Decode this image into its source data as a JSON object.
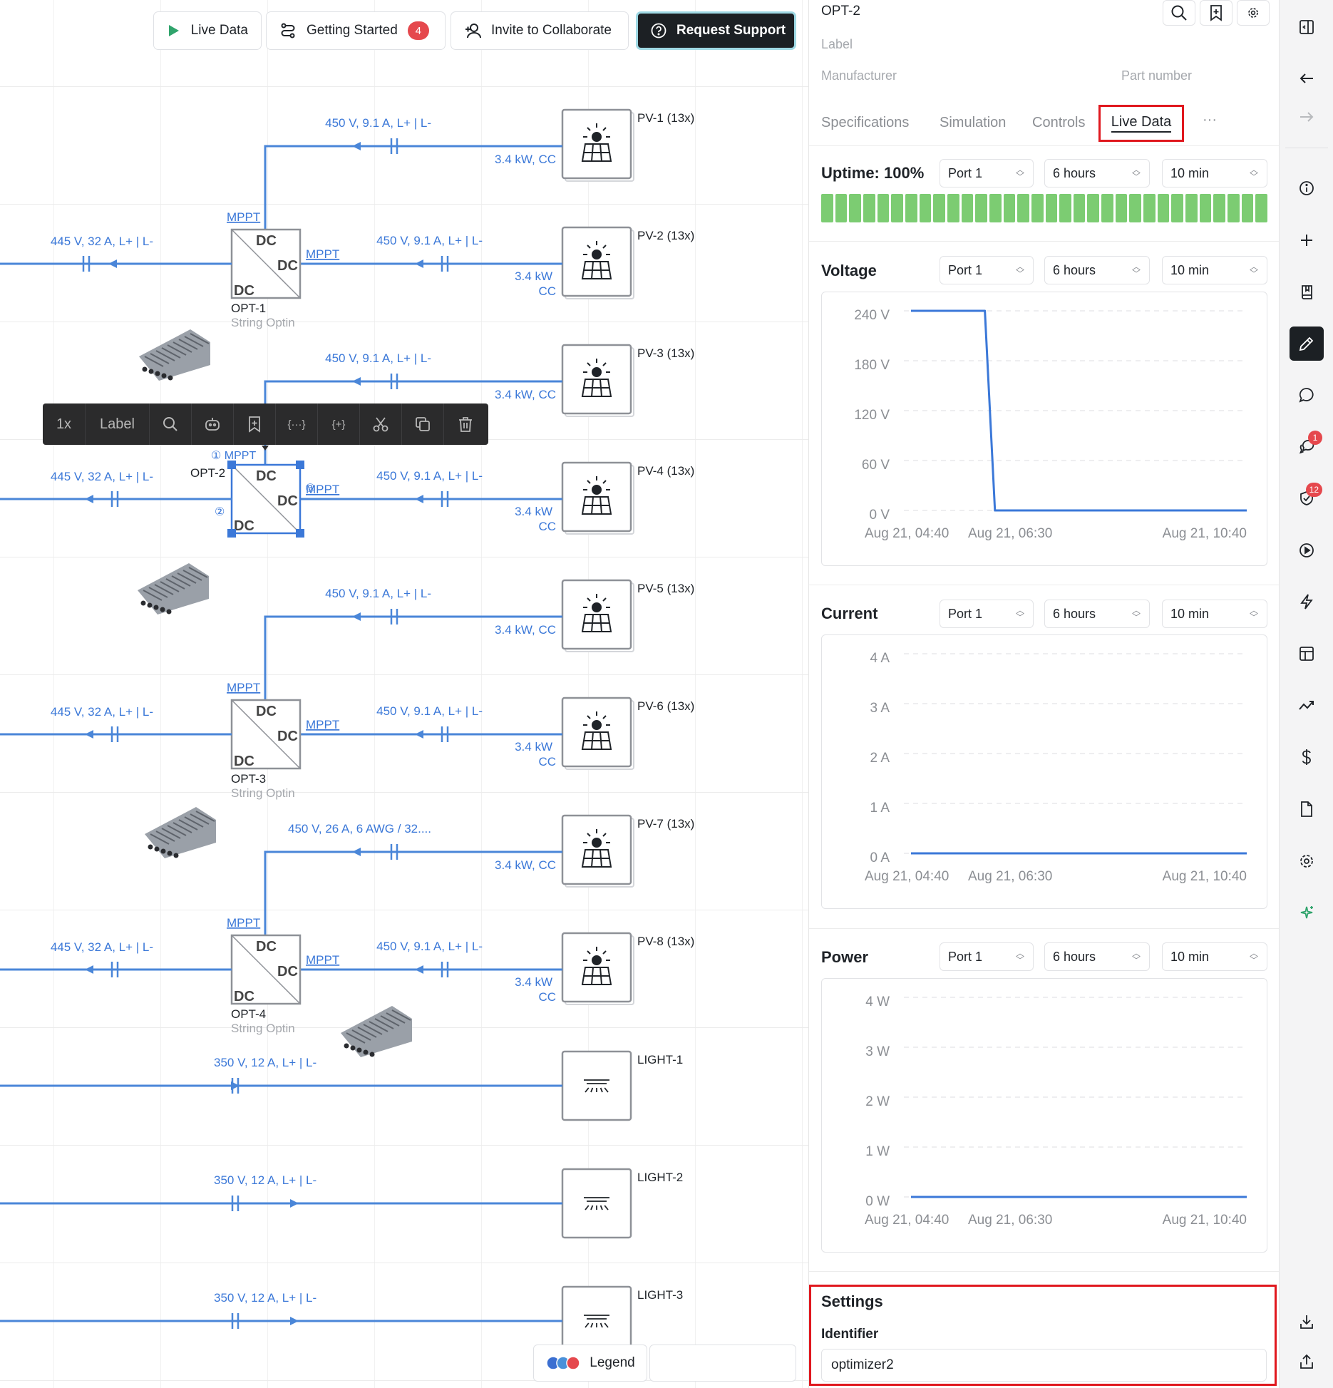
{
  "toolbar": {
    "live_data": "Live Data",
    "getting_started": "Getting Started",
    "getting_started_badge": "4",
    "invite": "Invite to Collaborate",
    "request_support": "Request Support"
  },
  "selection_toolbar": {
    "zoom": "1x",
    "label": "Label",
    "icons": [
      "search-icon",
      "robot-icon",
      "bookmark-plus-icon",
      "braces-icon",
      "braces-plus-icon",
      "cut-icon",
      "copy-icon",
      "trash-icon"
    ]
  },
  "diagram": {
    "pv_panels": [
      {
        "name": "PV-1 (13x)",
        "wire": "450 V, 9.1 A, L+ | L-",
        "power": "3.4 kW, CC"
      },
      {
        "name": "PV-2 (13x)",
        "wire": "450 V, 9.1 A, L+ | L-",
        "power": "3.4 kW CC"
      },
      {
        "name": "PV-3 (13x)",
        "wire": "450 V, 9.1 A, L+ | L-",
        "power": "3.4 kW, CC"
      },
      {
        "name": "PV-4 (13x)",
        "wire": "450 V, 9.1 A, L+ | L-",
        "power": "3.4 kW CC"
      },
      {
        "name": "PV-5 (13x)",
        "wire": "450 V, 9.1 A, L+ | L-",
        "power": "3.4 kW, CC"
      },
      {
        "name": "PV-6 (13x)",
        "wire": "450 V, 9.1 A, L+ | L-",
        "power": "3.4 kW CC"
      },
      {
        "name": "PV-7 (13x)",
        "wire": "450 V, 26 A, 6 AWG / 32....",
        "power": "3.4 kW, CC"
      },
      {
        "name": "PV-8 (13x)",
        "wire": "450 V, 9.1 A, L+ | L-",
        "power": "3.4 kW CC"
      }
    ],
    "optimizers": [
      {
        "name": "OPT-1",
        "sub": "String Optin",
        "out_wire": "445 V, 32 A, L+ | L-"
      },
      {
        "name": "OPT-2",
        "sub": "",
        "out_wire": "445 V, 32 A, L+ | L-"
      },
      {
        "name": "OPT-3",
        "sub": "String Optin",
        "out_wire": "445 V, 32 A, L+ | L-"
      },
      {
        "name": "OPT-4",
        "sub": "String Optin",
        "out_wire": "445 V, 32 A, L+ | L-"
      }
    ],
    "converter_label": "DC",
    "mppt_label": "MPPT",
    "port_markers": [
      "①",
      "②",
      "③"
    ],
    "lights": [
      {
        "name": "LIGHT-1",
        "wire": "350 V, 12 A, L+ | L-"
      },
      {
        "name": "LIGHT-2",
        "wire": "350 V, 12 A, L+ | L-"
      },
      {
        "name": "LIGHT-3",
        "wire": "350 V, 12 A, L+ | L-"
      }
    ]
  },
  "legend": {
    "label": "Legend",
    "colors": [
      "#3b6fd1",
      "#4a90d9",
      "#e5484d"
    ]
  },
  "panel": {
    "title": "OPT-2",
    "label_placeholder": "Label",
    "manufacturer_placeholder": "Manufacturer",
    "part_placeholder": "Part number",
    "tabs": [
      "Specifications",
      "Simulation",
      "Controls",
      "Live Data"
    ],
    "active_tab": "Live Data",
    "more": "···",
    "uptime": {
      "label": "Uptime: 100%",
      "port": "Port 1",
      "range": "6 hours",
      "interval": "10 min",
      "segments": 32,
      "color": "#7ccc72"
    },
    "x_labels": [
      "Aug 21, 04:40",
      "Aug 21, 06:30",
      "Aug 21, 10:40"
    ],
    "voltage": {
      "title": "Voltage",
      "port": "Port 1",
      "range": "6 hours",
      "interval": "10 min",
      "y_ticks": [
        "240 V",
        "180 V",
        "120 V",
        "60 V",
        "0 V"
      ]
    },
    "current": {
      "title": "Current",
      "port": "Port 1",
      "range": "6 hours",
      "interval": "10 min",
      "y_ticks": [
        "4 A",
        "3 A",
        "2 A",
        "1 A",
        "0 A"
      ]
    },
    "power": {
      "title": "Power",
      "port": "Port 1",
      "range": "6 hours",
      "interval": "10 min",
      "y_ticks": [
        "4 W",
        "3 W",
        "2 W",
        "1 W",
        "0 W"
      ]
    },
    "settings": {
      "title": "Settings",
      "identifier_label": "Identifier",
      "identifier_value": "optimizer2"
    }
  },
  "chart_data": [
    {
      "type": "line",
      "title": "Voltage",
      "ylim": [
        0,
        240
      ],
      "y_ticks": [
        240,
        180,
        120,
        60,
        0
      ],
      "x_labels": [
        "Aug 21, 04:40",
        "Aug 21, 06:30",
        "Aug 21, 10:40"
      ],
      "series": [
        {
          "values": [
            [
              0,
              240
            ],
            [
              0.22,
              240
            ],
            [
              0.25,
              0
            ],
            [
              1,
              0
            ]
          ]
        }
      ]
    },
    {
      "type": "line",
      "title": "Current",
      "ylim": [
        0,
        4
      ],
      "y_ticks": [
        4,
        3,
        2,
        1,
        0
      ],
      "x_labels": [
        "Aug 21, 04:40",
        "Aug 21, 06:30",
        "Aug 21, 10:40"
      ],
      "series": [
        {
          "values": [
            [
              0,
              0
            ],
            [
              1,
              0
            ]
          ]
        }
      ]
    },
    {
      "type": "line",
      "title": "Power",
      "ylim": [
        0,
        4
      ],
      "y_ticks": [
        4,
        3,
        2,
        1,
        0
      ],
      "x_labels": [
        "Aug 21, 04:40",
        "Aug 21, 06:30",
        "Aug 21, 10:40"
      ],
      "series": [
        {
          "values": [
            [
              0,
              0
            ],
            [
              1,
              0
            ]
          ]
        }
      ]
    }
  ],
  "rail": {
    "icons": [
      "panel-toggle-icon",
      "arrow-left-icon",
      "arrow-right-icon",
      "info-icon",
      "plus-icon",
      "book-icon",
      "pencil-icon",
      "comment-icon",
      "comments-icon",
      "shield-check-icon",
      "play-icon",
      "bolt-icon",
      "table-icon",
      "trend-icon",
      "dollar-icon",
      "file-icon",
      "gear-icon",
      "sparkle-icon",
      "download-icon",
      "share-icon"
    ],
    "active": "pencil-icon",
    "badges": {
      "comments-icon": "1",
      "shield-check-icon": "12"
    }
  },
  "colors": {
    "accent": "#3b78d8",
    "wire": "#4a86d8",
    "danger": "#e5484d",
    "uptime": "#7ccc72"
  }
}
